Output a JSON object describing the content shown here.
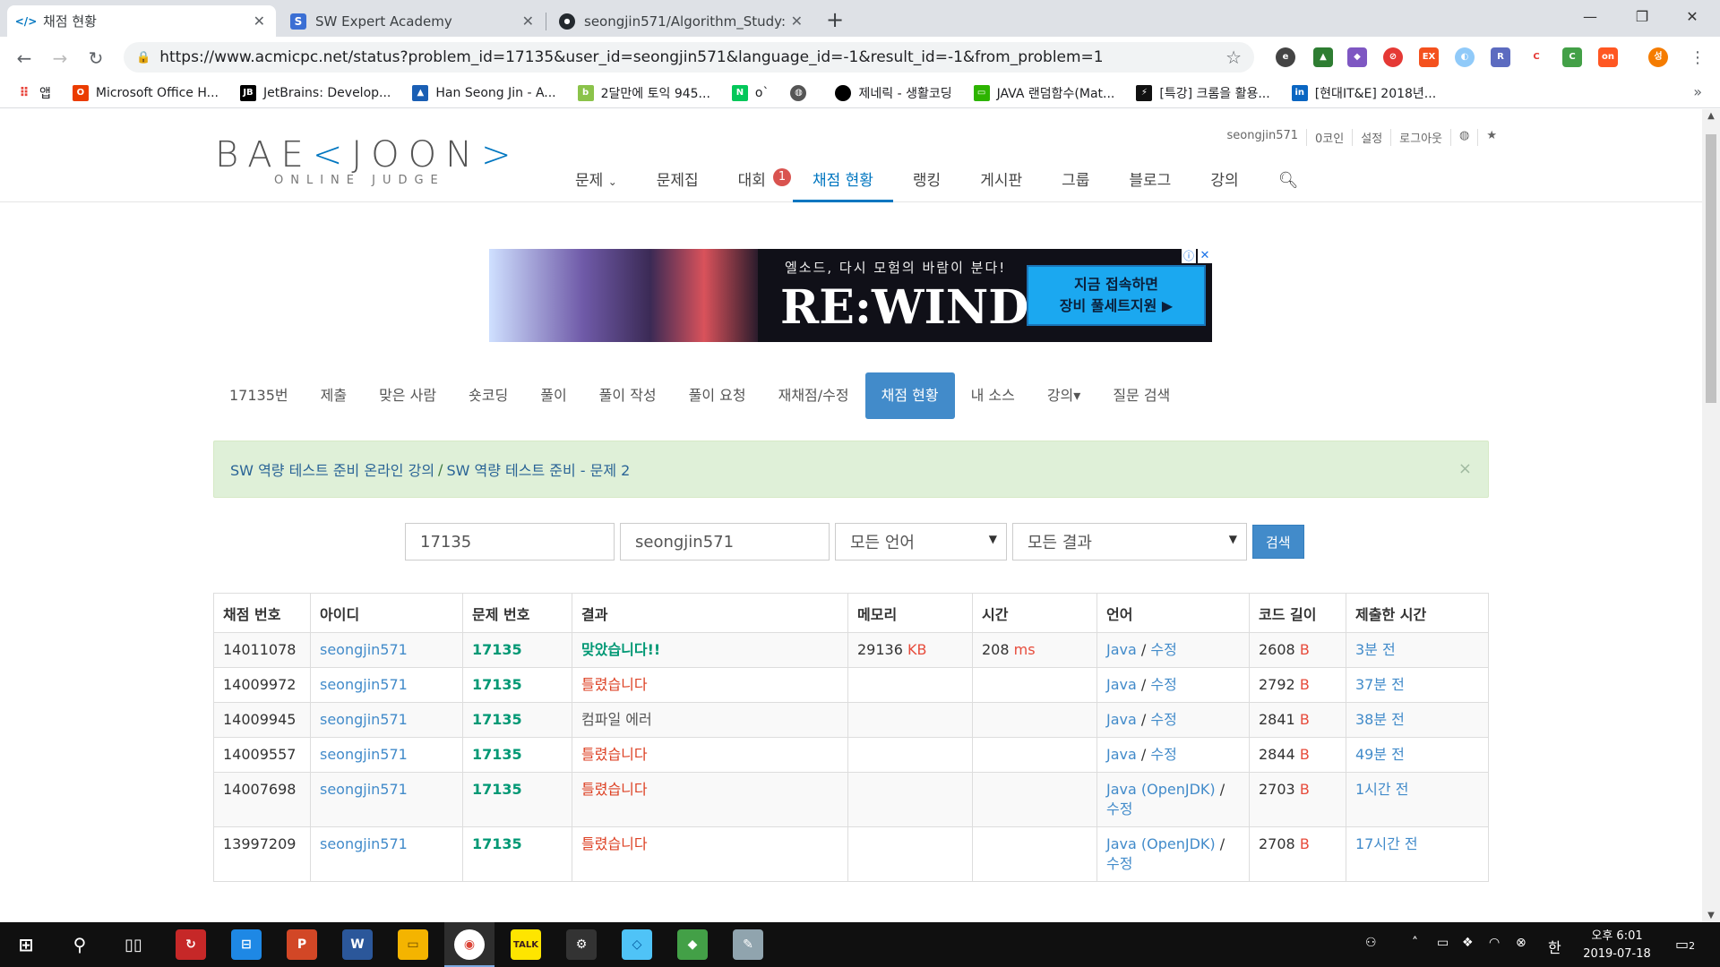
{
  "browser": {
    "tabs": [
      {
        "title": "채점 현황",
        "favicon": "</>",
        "active": true
      },
      {
        "title": "SW Expert Academy",
        "favicon": "S",
        "active": false
      },
      {
        "title": "seongjin571/Algorithm_Study: ",
        "favicon": "gh",
        "active": false
      }
    ],
    "url": "https://www.acmicpc.net/status?problem_id=17135&user_id=seongjin571&language_id=-1&result_id=-1&from_problem=1",
    "bookmarks": [
      {
        "label": "앱",
        "color": "#e8453c"
      },
      {
        "label": "Microsoft Office H...",
        "color": "#eb3c00"
      },
      {
        "label": "JetBrains: Develop...",
        "color": "#000000"
      },
      {
        "label": "Han Seong Jin - A...",
        "color": "#1a5fb4"
      },
      {
        "label": "2달만에 토익 945...",
        "color": "#8bc34a"
      },
      {
        "label": "o`",
        "color": "#03c75a"
      },
      {
        "label": "",
        "color": "#555555"
      },
      {
        "label": "제네릭 - 생활코딩",
        "color": "#000000"
      },
      {
        "label": "JAVA 랜덤함수(Mat...",
        "color": "#2db400"
      },
      {
        "label": "[특강] 크롬을 활용...",
        "color": "#111111"
      },
      {
        "label": "[현대IT&E] 2018년...",
        "color": "#0a66c2"
      }
    ],
    "more_label": "»"
  },
  "header": {
    "logo_main_a": "BAE",
    "logo_bracket_l": "<",
    "logo_main_b": "JOON",
    "logo_bracket_r": ">",
    "logo_sub": "ONLINE JUDGE",
    "top_menu": [
      "seongjin571",
      "0코인",
      "설정",
      "로그아웃"
    ],
    "nav": [
      {
        "label": "문제",
        "dropdown": "⌄"
      },
      {
        "label": "문제집"
      },
      {
        "label": "대회",
        "badge": "1"
      },
      {
        "label": "채점 현황",
        "active": true
      },
      {
        "label": "랭킹"
      },
      {
        "label": "게시판"
      },
      {
        "label": "그룹"
      },
      {
        "label": "블로그"
      },
      {
        "label": "강의"
      }
    ]
  },
  "ad": {
    "tagline": "엘소드, 다시 모험의 바람이 분다!",
    "brand": "RE:WIND",
    "cta_line1": "지금 접속하면",
    "cta_line2": "장비 풀세트지원 ▶"
  },
  "subnav": [
    "17135번",
    "제출",
    "맞은 사람",
    "숏코딩",
    "풀이",
    "풀이 작성",
    "풀이 요청",
    "재채점/수정",
    "채점 현황",
    "내 소스",
    "강의▾",
    "질문 검색"
  ],
  "alert": {
    "link1": "SW 역량 테스트 준비 온라인 강의",
    "sep": "/",
    "link2": "SW 역량 테스트 준비 - 문제 2",
    "close": "×"
  },
  "search": {
    "problem_id": "17135",
    "user_id": "seongjin571",
    "language": "모든 언어",
    "result": "모든 결과",
    "button": "검색"
  },
  "table": {
    "headers": [
      "채점 번호",
      "아이디",
      "문제 번호",
      "결과",
      "메모리",
      "시간",
      "언어",
      "코드 길이",
      "제출한 시간"
    ],
    "rows": [
      {
        "id": "14011078",
        "user": "seongjin571",
        "problem": "17135",
        "result": "맞았습니다!!",
        "result_type": "ac",
        "memory": "29136",
        "memory_unit": "KB",
        "time": "208",
        "time_unit": "ms",
        "lang": "Java",
        "edit": "수정",
        "length": "2608",
        "length_unit": "B",
        "submitted": "3분 전"
      },
      {
        "id": "14009972",
        "user": "seongjin571",
        "problem": "17135",
        "result": "틀렸습니다",
        "result_type": "wa",
        "memory": "",
        "memory_unit": "",
        "time": "",
        "time_unit": "",
        "lang": "Java",
        "edit": "수정",
        "length": "2792",
        "length_unit": "B",
        "submitted": "37분 전"
      },
      {
        "id": "14009945",
        "user": "seongjin571",
        "problem": "17135",
        "result": "컴파일 에러",
        "result_type": "ce",
        "memory": "",
        "memory_unit": "",
        "time": "",
        "time_unit": "",
        "lang": "Java",
        "edit": "수정",
        "length": "2841",
        "length_unit": "B",
        "submitted": "38분 전"
      },
      {
        "id": "14009557",
        "user": "seongjin571",
        "problem": "17135",
        "result": "틀렸습니다",
        "result_type": "wa",
        "memory": "",
        "memory_unit": "",
        "time": "",
        "time_unit": "",
        "lang": "Java",
        "edit": "수정",
        "length": "2844",
        "length_unit": "B",
        "submitted": "49분 전"
      },
      {
        "id": "14007698",
        "user": "seongjin571",
        "problem": "17135",
        "result": "틀렸습니다",
        "result_type": "wa",
        "memory": "",
        "memory_unit": "",
        "time": "",
        "time_unit": "",
        "lang": "Java (OpenJDK)",
        "edit": "수정",
        "length": "2703",
        "length_unit": "B",
        "submitted": "1시간 전"
      },
      {
        "id": "13997209",
        "user": "seongjin571",
        "problem": "17135",
        "result": "틀렸습니다",
        "result_type": "wa",
        "memory": "",
        "memory_unit": "",
        "time": "",
        "time_unit": "",
        "lang": "Java (OpenJDK)",
        "edit": "수정",
        "length": "2708",
        "length_unit": "B",
        "submitted": "17시간 전"
      }
    ]
  },
  "taskbar": {
    "clock_line1": "오후 6:01",
    "clock_line2": "2019-07-18",
    "ime": "한",
    "notifications": "2"
  },
  "colors": {
    "accent": "#0076c0",
    "button_blue": "#428bca",
    "accepted": "#009874",
    "wrong": "#dd4124",
    "alert_bg": "#dff0d8"
  }
}
